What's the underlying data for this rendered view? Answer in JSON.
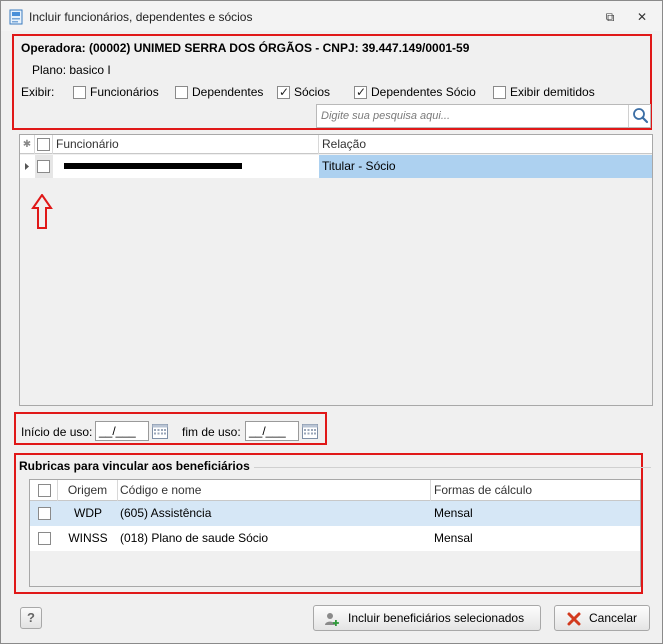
{
  "window": {
    "title": "Incluir funcionários, dependentes e sócios",
    "restore_glyph": "⧉",
    "close_glyph": "✕"
  },
  "header": {
    "operadora": "Operadora: (00002) UNIMED SERRA DOS ÓRGÃOS - CNPJ: 39.447.149/0001-59",
    "plano": "Plano: basico I",
    "exibir_label": "Exibir:",
    "filters": [
      {
        "label": "Funcionários",
        "checked": false
      },
      {
        "label": "Dependentes",
        "checked": false
      },
      {
        "label": "Sócios",
        "checked": true
      },
      {
        "label": "Dependentes Sócio",
        "checked": true
      },
      {
        "label": "Exibir demitidos",
        "checked": false
      }
    ],
    "search_placeholder": "Digite sua pesquisa aqui..."
  },
  "employees_grid": {
    "columns": [
      "Funcionário",
      "Relação"
    ],
    "rows": [
      {
        "funcionario": "",
        "relacao": "Titular - Sócio",
        "checked": false
      }
    ]
  },
  "dates": {
    "inicio_label": "Início de uso:",
    "inicio_value": "__/___",
    "fim_label": "fim de uso:",
    "fim_value": "__/___"
  },
  "rubricas": {
    "title": "Rubricas para vincular aos beneficiários",
    "columns": [
      "Origem",
      "Código e nome",
      "Formas de cálculo"
    ],
    "rows": [
      {
        "origem": "WDP",
        "codigo": "(605) Assistência",
        "forma": "Mensal",
        "selected": true
      },
      {
        "origem": "WINSS",
        "codigo": "(018) Plano de saude Sócio",
        "forma": "Mensal",
        "selected": false
      }
    ]
  },
  "footer": {
    "help_label": "?",
    "include_label": "Incluir beneficiários selecionados",
    "cancel_label": "Cancelar"
  },
  "colors": {
    "highlight_red": "#e01818",
    "selected_row": "#add1f0"
  }
}
